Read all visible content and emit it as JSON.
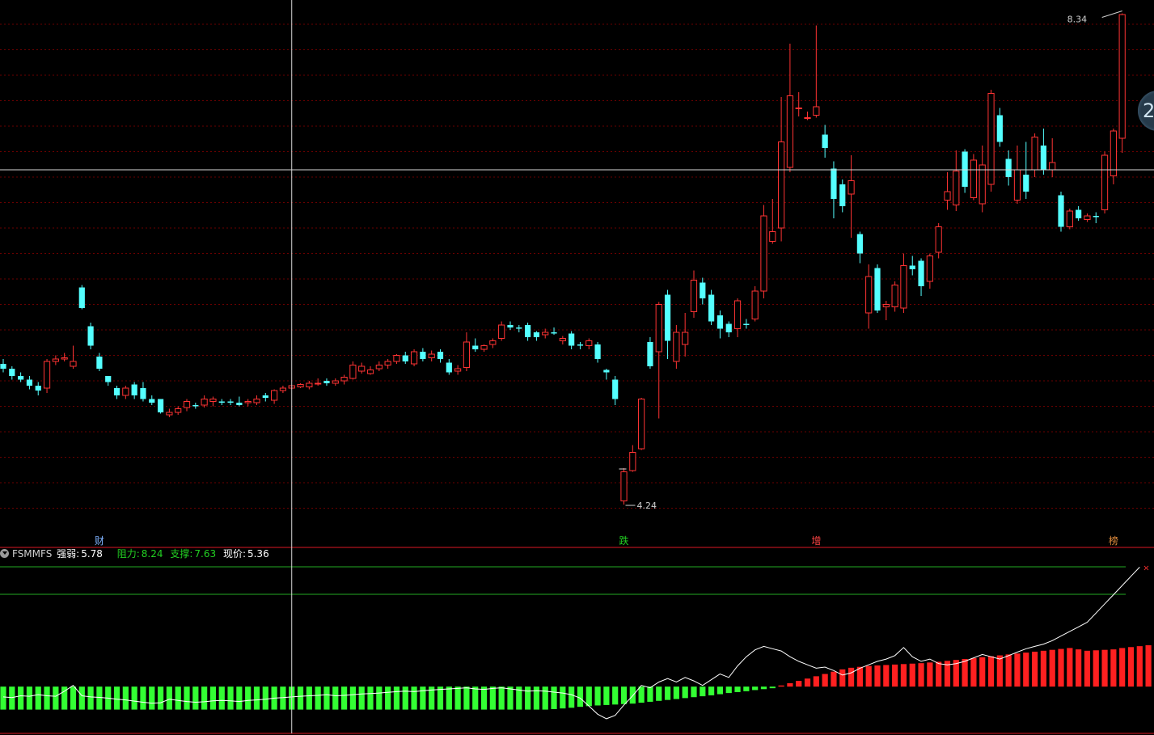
{
  "chart_data": {
    "type": "candlestick",
    "price_panel": {
      "ylim": [
        4.0,
        8.4
      ],
      "grid": true,
      "high_label": "8.34",
      "low_label": "4.24",
      "candles": [
        [
          5.4,
          5.36,
          5.44,
          5.33
        ],
        [
          5.36,
          5.3,
          5.38,
          5.27
        ],
        [
          5.3,
          5.27,
          5.33,
          5.25
        ],
        [
          5.27,
          5.22,
          5.3,
          5.19
        ],
        [
          5.22,
          5.18,
          5.25,
          5.14
        ],
        [
          5.2,
          5.42,
          5.44,
          5.16
        ],
        [
          5.42,
          5.44,
          5.47,
          5.39
        ],
        [
          5.44,
          5.45,
          5.49,
          5.42
        ],
        [
          5.38,
          5.42,
          5.55,
          5.36
        ],
        [
          6.03,
          5.86,
          6.05,
          5.85
        ],
        [
          5.71,
          5.55,
          5.74,
          5.52
        ],
        [
          5.46,
          5.36,
          5.49,
          5.34
        ],
        [
          5.3,
          5.25,
          5.3,
          5.22
        ],
        [
          5.2,
          5.14,
          5.22,
          5.11
        ],
        [
          5.14,
          5.2,
          5.22,
          5.11
        ],
        [
          5.23,
          5.14,
          5.25,
          5.11
        ],
        [
          5.2,
          5.11,
          5.25,
          5.09
        ],
        [
          5.11,
          5.08,
          5.14,
          5.06
        ],
        [
          5.11,
          5.0,
          5.11,
          4.99
        ],
        [
          4.98,
          5.0,
          5.03,
          4.96
        ],
        [
          5.0,
          5.03,
          5.05,
          4.98
        ],
        [
          5.04,
          5.09,
          5.11,
          5.01
        ],
        [
          5.06,
          5.05,
          5.08,
          5.03
        ],
        [
          5.06,
          5.11,
          5.14,
          5.04
        ],
        [
          5.09,
          5.11,
          5.13,
          5.05
        ],
        [
          5.09,
          5.08,
          5.11,
          5.06
        ],
        [
          5.09,
          5.08,
          5.11,
          5.06
        ],
        [
          5.08,
          5.06,
          5.13,
          5.05
        ],
        [
          5.08,
          5.09,
          5.11,
          5.05
        ],
        [
          5.08,
          5.11,
          5.14,
          5.06
        ],
        [
          5.14,
          5.12,
          5.16,
          5.09
        ],
        [
          5.1,
          5.18,
          5.19,
          5.07
        ],
        [
          5.18,
          5.2,
          5.22,
          5.16
        ],
        [
          5.2,
          5.22,
          5.22,
          5.19
        ],
        [
          5.21,
          5.23,
          5.24,
          5.2
        ],
        [
          5.21,
          5.24,
          5.26,
          5.19
        ],
        [
          5.24,
          5.24,
          5.28,
          5.22
        ],
        [
          5.26,
          5.24,
          5.28,
          5.22
        ],
        [
          5.24,
          5.26,
          5.28,
          5.22
        ],
        [
          5.26,
          5.29,
          5.31,
          5.23
        ],
        [
          5.28,
          5.39,
          5.42,
          5.27
        ],
        [
          5.34,
          5.38,
          5.41,
          5.32
        ],
        [
          5.32,
          5.35,
          5.38,
          5.31
        ],
        [
          5.36,
          5.39,
          5.42,
          5.34
        ],
        [
          5.39,
          5.42,
          5.44,
          5.36
        ],
        [
          5.42,
          5.47,
          5.48,
          5.4
        ],
        [
          5.47,
          5.42,
          5.5,
          5.4
        ],
        [
          5.4,
          5.5,
          5.52,
          5.38
        ],
        [
          5.5,
          5.44,
          5.53,
          5.42
        ],
        [
          5.45,
          5.48,
          5.51,
          5.42
        ],
        [
          5.5,
          5.44,
          5.52,
          5.41
        ],
        [
          5.41,
          5.33,
          5.44,
          5.31
        ],
        [
          5.34,
          5.36,
          5.39,
          5.31
        ],
        [
          5.37,
          5.58,
          5.66,
          5.34
        ],
        [
          5.55,
          5.52,
          5.61,
          5.5
        ],
        [
          5.52,
          5.55,
          5.56,
          5.5
        ],
        [
          5.56,
          5.59,
          5.61,
          5.53
        ],
        [
          5.61,
          5.72,
          5.75,
          5.59
        ],
        [
          5.72,
          5.7,
          5.75,
          5.68
        ],
        [
          5.7,
          5.69,
          5.72,
          5.66
        ],
        [
          5.72,
          5.62,
          5.74,
          5.59
        ],
        [
          5.66,
          5.62,
          5.67,
          5.59
        ],
        [
          5.64,
          5.66,
          5.69,
          5.61
        ],
        [
          5.66,
          5.65,
          5.7,
          5.64
        ],
        [
          5.59,
          5.61,
          5.63,
          5.56
        ],
        [
          5.65,
          5.55,
          5.67,
          5.52
        ],
        [
          5.56,
          5.55,
          5.58,
          5.52
        ],
        [
          5.55,
          5.59,
          5.61,
          5.52
        ],
        [
          5.56,
          5.44,
          5.58,
          5.41
        ],
        [
          5.35,
          5.33,
          5.36,
          5.27
        ],
        [
          5.27,
          5.11,
          5.3,
          5.06
        ],
        [
          4.27,
          4.51,
          4.54,
          4.24
        ],
        [
          4.52,
          4.67,
          4.73,
          4.51
        ],
        [
          4.7,
          5.11,
          5.12,
          4.69
        ],
        [
          5.58,
          5.38,
          5.62,
          5.36
        ],
        [
          5.5,
          5.89,
          5.91,
          4.95
        ],
        [
          5.97,
          5.59,
          6.01,
          5.44
        ],
        [
          5.42,
          5.66,
          5.72,
          5.36
        ],
        [
          5.56,
          5.66,
          5.82,
          5.46
        ],
        [
          5.83,
          6.09,
          6.17,
          5.78
        ],
        [
          6.07,
          5.94,
          6.11,
          5.89
        ],
        [
          5.97,
          5.75,
          6.01,
          5.72
        ],
        [
          5.8,
          5.69,
          5.84,
          5.61
        ],
        [
          5.73,
          5.66,
          5.75,
          5.62
        ],
        [
          5.69,
          5.92,
          5.94,
          5.62
        ],
        [
          5.73,
          5.72,
          5.77,
          5.69
        ],
        [
          5.77,
          6.0,
          6.04,
          5.75
        ],
        [
          6.0,
          6.62,
          6.71,
          5.94
        ],
        [
          6.41,
          6.49,
          6.76,
          6.39
        ],
        [
          6.52,
          7.23,
          7.6,
          6.41
        ],
        [
          7.02,
          7.61,
          8.04,
          6.98
        ],
        [
          7.51,
          7.51,
          7.64,
          7.44
        ],
        [
          7.43,
          7.43,
          7.48,
          7.41
        ],
        [
          7.45,
          7.52,
          8.19,
          7.43
        ],
        [
          7.29,
          7.18,
          7.37,
          7.1
        ],
        [
          7.01,
          6.76,
          7.07,
          6.6
        ],
        [
          6.88,
          6.7,
          6.92,
          6.65
        ],
        [
          6.8,
          6.91,
          7.12,
          6.44
        ],
        [
          6.47,
          6.31,
          6.49,
          6.23
        ],
        [
          5.82,
          6.12,
          6.22,
          5.69
        ],
        [
          6.19,
          5.84,
          6.22,
          5.82
        ],
        [
          5.87,
          5.89,
          5.92,
          5.76
        ],
        [
          5.87,
          6.05,
          6.08,
          5.83
        ],
        [
          5.86,
          6.21,
          6.31,
          5.82
        ],
        [
          6.21,
          6.18,
          6.29,
          6.13
        ],
        [
          6.25,
          6.04,
          6.27,
          5.96
        ],
        [
          6.08,
          6.29,
          6.31,
          6.02
        ],
        [
          6.32,
          6.53,
          6.56,
          6.27
        ],
        [
          6.75,
          6.82,
          6.98,
          6.67
        ],
        [
          6.71,
          6.99,
          7.16,
          6.66
        ],
        [
          7.15,
          6.86,
          7.17,
          6.81
        ],
        [
          6.77,
          7.08,
          7.13,
          6.75
        ],
        [
          6.72,
          7.04,
          7.2,
          6.65
        ],
        [
          6.88,
          7.63,
          7.66,
          6.82
        ],
        [
          7.45,
          7.23,
          7.51,
          7.19
        ],
        [
          7.09,
          6.94,
          7.16,
          6.87
        ],
        [
          6.75,
          7.0,
          7.2,
          6.72
        ],
        [
          6.96,
          6.82,
          7.23,
          6.76
        ],
        [
          7.0,
          7.27,
          7.3,
          6.94
        ],
        [
          7.2,
          7.0,
          7.34,
          6.96
        ],
        [
          7.0,
          7.06,
          7.26,
          6.94
        ],
        [
          6.79,
          6.53,
          6.82,
          6.49
        ],
        [
          6.53,
          6.66,
          6.68,
          6.51
        ],
        [
          6.67,
          6.6,
          6.7,
          6.58
        ],
        [
          6.59,
          6.62,
          6.64,
          6.57
        ],
        [
          6.62,
          6.61,
          6.65,
          6.56
        ],
        [
          6.67,
          7.12,
          7.15,
          6.64
        ],
        [
          6.95,
          7.32,
          7.34,
          6.88
        ],
        [
          7.26,
          8.28,
          8.29,
          7.14
        ]
      ]
    },
    "indicator_panel": {
      "name": "FSMMFS",
      "lines_h": [
        8.24,
        7.63
      ],
      "bars": [
        -1.0,
        -1.0,
        -1.0,
        -1.0,
        -1.0,
        -1.0,
        -1.0,
        -1.0,
        -1.0,
        -1.0,
        -1.0,
        -1.0,
        -1.0,
        -1.0,
        -1.0,
        -1.0,
        -1.0,
        -1.0,
        -1.0,
        -1.0,
        -1.0,
        -1.0,
        -1.0,
        -1.0,
        -1.0,
        -1.0,
        -1.0,
        -1.0,
        -1.0,
        -1.0,
        -1.0,
        -1.0,
        -1.0,
        -1.0,
        -1.0,
        -1.0,
        -1.0,
        -1.0,
        -1.0,
        -1.0,
        -1.0,
        -1.0,
        -1.0,
        -1.0,
        -1.0,
        -1.0,
        -1.0,
        -1.0,
        -1.0,
        -1.0,
        -1.0,
        -1.0,
        -1.0,
        -1.0,
        -1.0,
        -1.0,
        -1.0,
        -1.0,
        -1.0,
        -1.0,
        -1.0,
        -1.0,
        -1.0,
        -0.98,
        -0.95,
        -0.92,
        -0.88,
        -0.85,
        -0.82,
        -0.8,
        -0.78,
        -0.76,
        -0.74,
        -0.7,
        -0.66,
        -0.62,
        -0.58,
        -0.54,
        -0.5,
        -0.46,
        -0.42,
        -0.38,
        -0.33,
        -0.28,
        -0.24,
        -0.2,
        -0.15,
        -0.11,
        -0.07,
        0.05,
        0.15,
        0.25,
        0.35,
        0.45,
        0.55,
        0.65,
        0.75,
        0.82,
        0.86,
        0.9,
        0.92,
        0.94,
        0.96,
        0.98,
        1.0,
        1.02,
        1.05,
        1.08,
        1.12,
        1.16,
        1.2,
        1.24,
        1.28,
        1.32,
        1.36,
        1.4,
        1.44,
        1.48,
        1.52,
        1.56,
        1.6,
        1.64,
        1.68,
        1.62,
        1.56,
        1.58,
        1.6,
        1.62,
        1.68,
        1.72,
        1.76,
        1.8,
        1.95
      ],
      "line": [
        -0.45,
        -0.48,
        -0.4,
        -0.42,
        -0.35,
        -0.4,
        -0.42,
        -0.2,
        0.05,
        -0.4,
        -0.45,
        -0.47,
        -0.5,
        -0.55,
        -0.58,
        -0.63,
        -0.68,
        -0.72,
        -0.7,
        -0.55,
        -0.6,
        -0.65,
        -0.68,
        -0.66,
        -0.62,
        -0.6,
        -0.62,
        -0.65,
        -0.6,
        -0.58,
        -0.55,
        -0.5,
        -0.48,
        -0.45,
        -0.42,
        -0.4,
        -0.38,
        -0.35,
        -0.4,
        -0.38,
        -0.35,
        -0.32,
        -0.3,
        -0.28,
        -0.25,
        -0.22,
        -0.2,
        -0.22,
        -0.18,
        -0.15,
        -0.12,
        -0.1,
        -0.08,
        -0.05,
        -0.1,
        -0.12,
        -0.08,
        -0.05,
        -0.1,
        -0.15,
        -0.2,
        -0.18,
        -0.2,
        -0.24,
        -0.28,
        -0.35,
        -0.5,
        -0.85,
        -1.2,
        -1.4,
        -1.25,
        -0.8,
        -0.4,
        0.05,
        -0.05,
        0.2,
        0.35,
        0.2,
        0.4,
        0.25,
        0.05,
        0.3,
        0.55,
        0.4,
        0.9,
        1.3,
        1.6,
        1.75,
        1.65,
        1.55,
        1.3,
        1.1,
        0.95,
        0.8,
        0.85,
        0.7,
        0.5,
        0.6,
        0.8,
        0.95,
        1.1,
        1.2,
        1.35,
        1.7,
        1.3,
        1.1,
        1.2,
        1.0,
        0.95,
        1.0,
        1.1,
        1.25,
        1.4,
        1.3,
        1.2,
        1.35,
        1.5,
        1.65,
        1.75,
        1.85,
        2.0,
        2.2,
        2.4,
        2.6,
        2.8,
        3.2,
        3.6,
        4.0,
        4.4,
        4.8,
        5.2
      ],
      "ylim": [
        -2.0,
        5.6
      ]
    },
    "markers": [
      {
        "index": 11,
        "label": "财",
        "color": "#7fb3ff"
      },
      {
        "index": 71,
        "label": "跌",
        "color": "#22d022"
      },
      {
        "index": 93,
        "label": "增",
        "color": "#ff4444"
      },
      {
        "index": 127,
        "label": "榜",
        "color": "#e08b3c"
      }
    ],
    "crosshair": {
      "index": 33,
      "price": 7.0
    }
  },
  "indicator_header": {
    "name": "FSMMFS",
    "strength_label": "强弱:",
    "strength_value": "5.78",
    "resistance_label": "阻力:",
    "resistance_value": "8.24",
    "support_label": "支撑:",
    "support_value": "7.63",
    "price_label": "现价:",
    "price_value": "5.36"
  },
  "side_button": {
    "label": "2"
  },
  "colors": {
    "up": "#ff3333",
    "down": "#54ffff",
    "bar_pos": "#ff2020",
    "bar_neg": "#33ff33",
    "grid": "#6a0000",
    "divider": "#b0141e",
    "level_line": "#22aa22"
  }
}
